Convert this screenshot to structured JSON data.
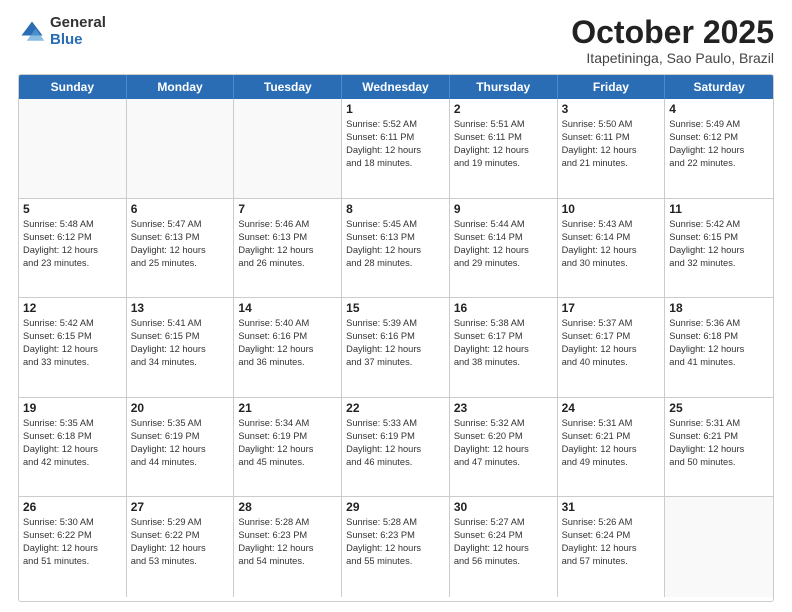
{
  "logo": {
    "general": "General",
    "blue": "Blue"
  },
  "header": {
    "month": "October 2025",
    "location": "Itapetininga, Sao Paulo, Brazil"
  },
  "weekdays": [
    "Sunday",
    "Monday",
    "Tuesday",
    "Wednesday",
    "Thursday",
    "Friday",
    "Saturday"
  ],
  "weeks": [
    [
      {
        "day": "",
        "lines": [],
        "empty": true
      },
      {
        "day": "",
        "lines": [],
        "empty": true
      },
      {
        "day": "",
        "lines": [],
        "empty": true
      },
      {
        "day": "1",
        "lines": [
          "Sunrise: 5:52 AM",
          "Sunset: 6:11 PM",
          "Daylight: 12 hours",
          "and 18 minutes."
        ]
      },
      {
        "day": "2",
        "lines": [
          "Sunrise: 5:51 AM",
          "Sunset: 6:11 PM",
          "Daylight: 12 hours",
          "and 19 minutes."
        ]
      },
      {
        "day": "3",
        "lines": [
          "Sunrise: 5:50 AM",
          "Sunset: 6:11 PM",
          "Daylight: 12 hours",
          "and 21 minutes."
        ]
      },
      {
        "day": "4",
        "lines": [
          "Sunrise: 5:49 AM",
          "Sunset: 6:12 PM",
          "Daylight: 12 hours",
          "and 22 minutes."
        ]
      }
    ],
    [
      {
        "day": "5",
        "lines": [
          "Sunrise: 5:48 AM",
          "Sunset: 6:12 PM",
          "Daylight: 12 hours",
          "and 23 minutes."
        ]
      },
      {
        "day": "6",
        "lines": [
          "Sunrise: 5:47 AM",
          "Sunset: 6:13 PM",
          "Daylight: 12 hours",
          "and 25 minutes."
        ]
      },
      {
        "day": "7",
        "lines": [
          "Sunrise: 5:46 AM",
          "Sunset: 6:13 PM",
          "Daylight: 12 hours",
          "and 26 minutes."
        ]
      },
      {
        "day": "8",
        "lines": [
          "Sunrise: 5:45 AM",
          "Sunset: 6:13 PM",
          "Daylight: 12 hours",
          "and 28 minutes."
        ]
      },
      {
        "day": "9",
        "lines": [
          "Sunrise: 5:44 AM",
          "Sunset: 6:14 PM",
          "Daylight: 12 hours",
          "and 29 minutes."
        ]
      },
      {
        "day": "10",
        "lines": [
          "Sunrise: 5:43 AM",
          "Sunset: 6:14 PM",
          "Daylight: 12 hours",
          "and 30 minutes."
        ]
      },
      {
        "day": "11",
        "lines": [
          "Sunrise: 5:42 AM",
          "Sunset: 6:15 PM",
          "Daylight: 12 hours",
          "and 32 minutes."
        ]
      }
    ],
    [
      {
        "day": "12",
        "lines": [
          "Sunrise: 5:42 AM",
          "Sunset: 6:15 PM",
          "Daylight: 12 hours",
          "and 33 minutes."
        ]
      },
      {
        "day": "13",
        "lines": [
          "Sunrise: 5:41 AM",
          "Sunset: 6:15 PM",
          "Daylight: 12 hours",
          "and 34 minutes."
        ]
      },
      {
        "day": "14",
        "lines": [
          "Sunrise: 5:40 AM",
          "Sunset: 6:16 PM",
          "Daylight: 12 hours",
          "and 36 minutes."
        ]
      },
      {
        "day": "15",
        "lines": [
          "Sunrise: 5:39 AM",
          "Sunset: 6:16 PM",
          "Daylight: 12 hours",
          "and 37 minutes."
        ]
      },
      {
        "day": "16",
        "lines": [
          "Sunrise: 5:38 AM",
          "Sunset: 6:17 PM",
          "Daylight: 12 hours",
          "and 38 minutes."
        ]
      },
      {
        "day": "17",
        "lines": [
          "Sunrise: 5:37 AM",
          "Sunset: 6:17 PM",
          "Daylight: 12 hours",
          "and 40 minutes."
        ]
      },
      {
        "day": "18",
        "lines": [
          "Sunrise: 5:36 AM",
          "Sunset: 6:18 PM",
          "Daylight: 12 hours",
          "and 41 minutes."
        ]
      }
    ],
    [
      {
        "day": "19",
        "lines": [
          "Sunrise: 5:35 AM",
          "Sunset: 6:18 PM",
          "Daylight: 12 hours",
          "and 42 minutes."
        ]
      },
      {
        "day": "20",
        "lines": [
          "Sunrise: 5:35 AM",
          "Sunset: 6:19 PM",
          "Daylight: 12 hours",
          "and 44 minutes."
        ]
      },
      {
        "day": "21",
        "lines": [
          "Sunrise: 5:34 AM",
          "Sunset: 6:19 PM",
          "Daylight: 12 hours",
          "and 45 minutes."
        ]
      },
      {
        "day": "22",
        "lines": [
          "Sunrise: 5:33 AM",
          "Sunset: 6:19 PM",
          "Daylight: 12 hours",
          "and 46 minutes."
        ]
      },
      {
        "day": "23",
        "lines": [
          "Sunrise: 5:32 AM",
          "Sunset: 6:20 PM",
          "Daylight: 12 hours",
          "and 47 minutes."
        ]
      },
      {
        "day": "24",
        "lines": [
          "Sunrise: 5:31 AM",
          "Sunset: 6:21 PM",
          "Daylight: 12 hours",
          "and 49 minutes."
        ]
      },
      {
        "day": "25",
        "lines": [
          "Sunrise: 5:31 AM",
          "Sunset: 6:21 PM",
          "Daylight: 12 hours",
          "and 50 minutes."
        ]
      }
    ],
    [
      {
        "day": "26",
        "lines": [
          "Sunrise: 5:30 AM",
          "Sunset: 6:22 PM",
          "Daylight: 12 hours",
          "and 51 minutes."
        ]
      },
      {
        "day": "27",
        "lines": [
          "Sunrise: 5:29 AM",
          "Sunset: 6:22 PM",
          "Daylight: 12 hours",
          "and 53 minutes."
        ]
      },
      {
        "day": "28",
        "lines": [
          "Sunrise: 5:28 AM",
          "Sunset: 6:23 PM",
          "Daylight: 12 hours",
          "and 54 minutes."
        ]
      },
      {
        "day": "29",
        "lines": [
          "Sunrise: 5:28 AM",
          "Sunset: 6:23 PM",
          "Daylight: 12 hours",
          "and 55 minutes."
        ]
      },
      {
        "day": "30",
        "lines": [
          "Sunrise: 5:27 AM",
          "Sunset: 6:24 PM",
          "Daylight: 12 hours",
          "and 56 minutes."
        ]
      },
      {
        "day": "31",
        "lines": [
          "Sunrise: 5:26 AM",
          "Sunset: 6:24 PM",
          "Daylight: 12 hours",
          "and 57 minutes."
        ]
      },
      {
        "day": "",
        "lines": [],
        "empty": true
      }
    ]
  ]
}
